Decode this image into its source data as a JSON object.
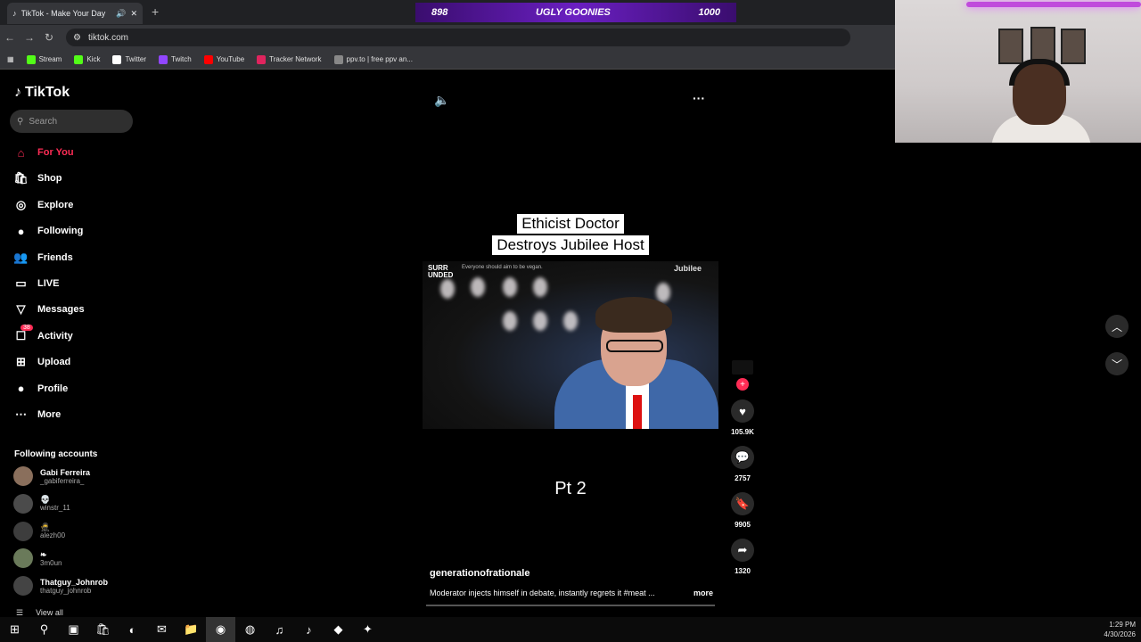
{
  "browser": {
    "tab_title": "TikTok - Make Your Day",
    "url": "tiktok.com",
    "bookmarks": [
      {
        "label": "Stream",
        "color": "#53fc18"
      },
      {
        "label": "Kick",
        "color": "#53fc18"
      },
      {
        "label": "Twitter",
        "color": "#ffffff"
      },
      {
        "label": "Twitch",
        "color": "#9146ff"
      },
      {
        "label": "YouTube",
        "color": "#ff0000"
      },
      {
        "label": "Tracker Network",
        "color": "#e0245e"
      },
      {
        "label": "ppv.to | free ppv an...",
        "color": "#888888"
      }
    ]
  },
  "overlay": {
    "left": "898",
    "center": "UGLY GOONIES",
    "right": "1000"
  },
  "sidebar": {
    "logo": "TikTok",
    "search_placeholder": "Search",
    "nav": [
      {
        "label": "For You",
        "icon": "home-icon",
        "active": true
      },
      {
        "label": "Shop",
        "icon": "shop-icon"
      },
      {
        "label": "Explore",
        "icon": "compass-icon"
      },
      {
        "label": "Following",
        "icon": "following-avatar-icon"
      },
      {
        "label": "Friends",
        "icon": "friends-icon"
      },
      {
        "label": "LIVE",
        "icon": "live-icon"
      },
      {
        "label": "Messages",
        "icon": "messages-icon"
      },
      {
        "label": "Activity",
        "icon": "activity-icon",
        "badge": "38"
      },
      {
        "label": "Upload",
        "icon": "upload-icon"
      },
      {
        "label": "Profile",
        "icon": "profile-icon"
      },
      {
        "label": "More",
        "icon": "more-icon"
      }
    ],
    "following_header": "Following accounts",
    "accounts": [
      {
        "name": "Gabi Ferreira",
        "handle": "_gabiferreira_"
      },
      {
        "name": "💀",
        "handle": "winstr_11"
      },
      {
        "name": "🥷",
        "handle": "alezh00"
      },
      {
        "name": "❧",
        "handle": "3m0un"
      },
      {
        "name": "Thatguy_Johnrob",
        "handle": "thatguy_johnrob"
      }
    ],
    "view_all": "View all"
  },
  "video": {
    "caption_line1": "Ethicist Doctor",
    "caption_line2": "Destroys Jubilee Host",
    "clip_left": "SURR\nUNDED",
    "clip_text": "Everyone should aim to be vegan.",
    "clip_brand": "Jubilee",
    "overlay_text": "Pt 2",
    "author": "generationofrationale",
    "description": "Moderator injects himself in debate, instantly regrets it #meat ...",
    "more": "more",
    "likes": "105.9K",
    "comments": "2757",
    "saves": "9905",
    "shares": "1320"
  },
  "taskbar": {
    "time": "1:29 PM",
    "date": "4/30/2026"
  }
}
